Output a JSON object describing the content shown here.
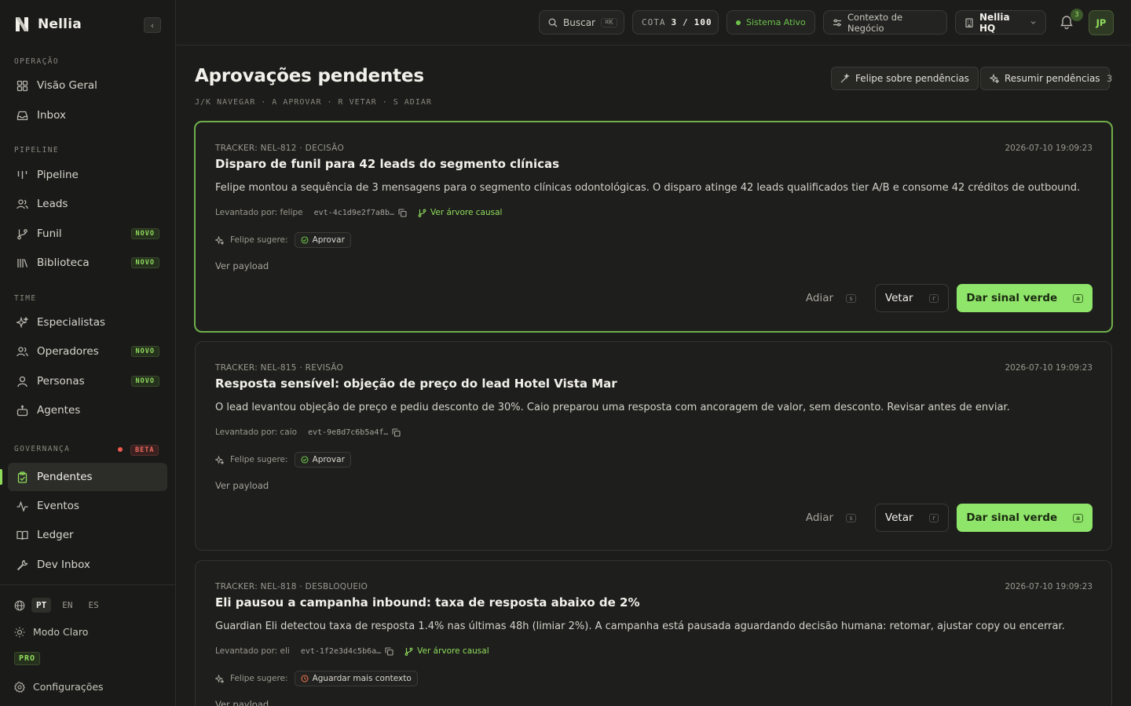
{
  "brand": {
    "name": "Nellia"
  },
  "sidebar": {
    "sections": {
      "operacao": "OPERAÇÃO",
      "pipeline": "PIPELINE",
      "time": "TIME",
      "governanca": "GOVERNANÇA"
    },
    "items": {
      "visao_geral": "Visão Geral",
      "inbox": "Inbox",
      "pipeline": "Pipeline",
      "leads": "Leads",
      "funil": "Funil",
      "biblioteca": "Biblioteca",
      "especialistas": "Especialistas",
      "operadores": "Operadores",
      "personas": "Personas",
      "agentes": "Agentes",
      "pendentes": "Pendentes",
      "eventos": "Eventos",
      "ledger": "Ledger",
      "dev_inbox": "Dev Inbox"
    },
    "badge_novo": "NOVO",
    "badge_beta": "BETA",
    "languages": [
      "PT",
      "EN",
      "ES"
    ],
    "active_language": "PT",
    "theme_toggle": "Modo Claro",
    "plan_badge": "PRO",
    "settings": "Configurações"
  },
  "topbar": {
    "search_label": "Buscar",
    "search_shortcut": "⌘K",
    "quota_label": "COTA",
    "quota_used": "3",
    "quota_sep": "/",
    "quota_total": "100",
    "status": "Sistema Ativo",
    "context": "Contexto de Negócio",
    "workspace": "Nellia HQ",
    "notifications": "3",
    "avatar": "JP"
  },
  "page": {
    "title": "Aprovações pendentes",
    "shortcuts": "J/K NAVEGAR · A APROVAR · R VETAR · S ADIAR",
    "btn_felipe": "Felipe sobre pendências",
    "btn_resumir": "Resumir pendências",
    "count": "3"
  },
  "labels": {
    "raised_by": "Levantado por:",
    "causal_tree": "Ver árvore causal",
    "felipe_suggests": "Felipe sugere:",
    "view_payload": "Ver payload",
    "adiar": "Adiar",
    "adiar_key": "s",
    "vetar": "Vetar",
    "vetar_key": "r",
    "aprovar_btn": "Dar sinal verde",
    "aprovar_key": "a"
  },
  "cards": [
    {
      "tracker": "TRACKER: NEL-812 · DECISÃO",
      "timestamp": "2026-07-10 19:09:23",
      "title": "Disparo de funil para 42 leads do segmento clínicas",
      "description": "Felipe montou a sequência de 3 mensagens para o segmento clínicas odontológicas. O disparo atinge 42 leads qualificados tier A/B e consome 42 créditos de outbound.",
      "raised_by": "felipe",
      "event_id": "evt-4c1d9e2f7a8b…",
      "suggestion": "Aprovar"
    },
    {
      "tracker": "TRACKER: NEL-815 · REVISÃO",
      "timestamp": "2026-07-10 19:09:23",
      "title": "Resposta sensível: objeção de preço do lead Hotel Vista Mar",
      "description": "O lead levantou objeção de preço e pediu desconto de 30%. Caio preparou uma resposta com ancoragem de valor, sem desconto. Revisar antes de enviar.",
      "raised_by": "caio",
      "event_id": "evt-9e8d7c6b5a4f…",
      "suggestion": "Aprovar"
    },
    {
      "tracker": "TRACKER: NEL-818 · DESBLOQUEIO",
      "timestamp": "2026-07-10 19:09:23",
      "title": "Eli pausou a campanha inbound: taxa de resposta abaixo de 2%",
      "description": "Guardian Eli detectou taxa de resposta 1.4% nas últimas 48h (limiar 2%). A campanha está pausada aguardando decisão humana: retomar, ajustar copy ou encerrar.",
      "raised_by": "eli",
      "event_id": "evt-1f2e3d4c5b6a…",
      "suggestion": "Aguardar mais contexto"
    }
  ],
  "colors": {
    "accent": "#8fe46a",
    "background": "#1c1c1a",
    "beta": "#ee5a4e"
  }
}
